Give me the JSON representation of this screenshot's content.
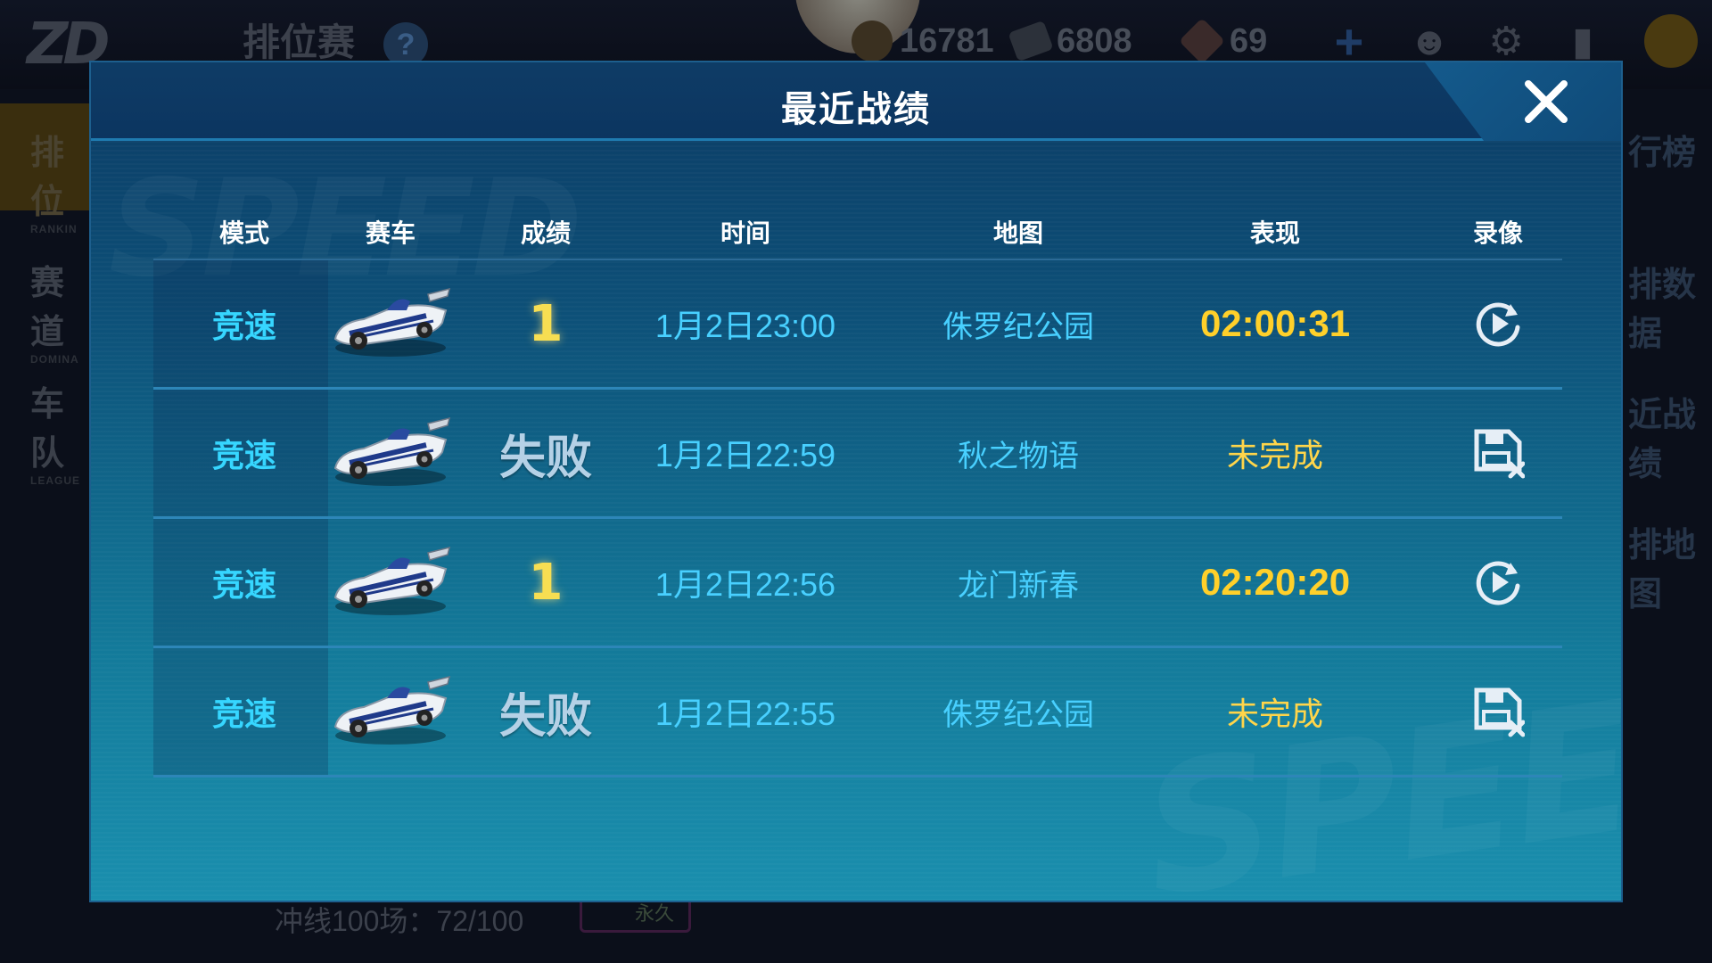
{
  "background": {
    "title": "排位赛",
    "help": "?",
    "resources": {
      "coin": "16781",
      "coupon": "6808",
      "gem": "69"
    },
    "left_menu": [
      {
        "label": "排位",
        "sub": "RANKIN"
      },
      {
        "label": "赛道",
        "sub": "DOMINA"
      },
      {
        "label": "车队",
        "sub": "LEAGUE"
      }
    ],
    "right_menu": [
      "行榜",
      "排数据",
      "近战绩",
      "排地图"
    ],
    "bottom_progress": "冲线100场：72/100",
    "bottom_badge": "永久"
  },
  "dialog": {
    "title": "最近战绩",
    "close_icon": "close-icon",
    "columns": [
      "模式",
      "赛车",
      "成绩",
      "时间",
      "地图",
      "表现",
      "录像"
    ],
    "rows": [
      {
        "mode": "竞速",
        "car_icon": "race-car-icon",
        "result": "1",
        "result_type": "rank",
        "time": "1月2日23:00",
        "map": "侏罗纪公园",
        "performance": "02:00:31",
        "perf_type": "time",
        "replay_icon": "replay-icon"
      },
      {
        "mode": "竞速",
        "car_icon": "race-car-icon",
        "result": "失败",
        "result_type": "fail",
        "time": "1月2日22:59",
        "map": "秋之物语",
        "performance": "未完成",
        "perf_type": "text",
        "replay_icon": "no-replay-icon"
      },
      {
        "mode": "竞速",
        "car_icon": "race-car-icon",
        "result": "1",
        "result_type": "rank",
        "time": "1月2日22:56",
        "map": "龙门新春",
        "performance": "02:20:20",
        "perf_type": "time",
        "replay_icon": "replay-icon"
      },
      {
        "mode": "竞速",
        "car_icon": "race-car-icon",
        "result": "失败",
        "result_type": "fail",
        "time": "1月2日22:55",
        "map": "侏罗纪公园",
        "performance": "未完成",
        "perf_type": "text",
        "replay_icon": "no-replay-icon"
      }
    ]
  },
  "colors": {
    "mode": "#36d6ff",
    "rank": "#f7de52",
    "time": "#48d0ff",
    "performance": "#ffd02a"
  }
}
